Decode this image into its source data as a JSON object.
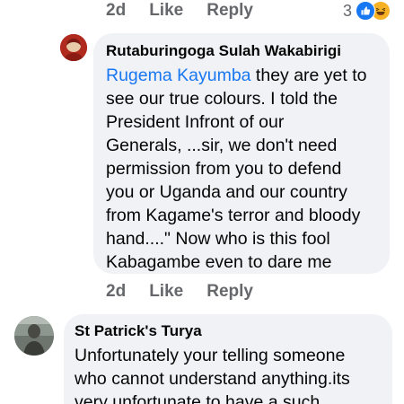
{
  "top_actions": {
    "time": "2d",
    "like": "Like",
    "reply": "Reply",
    "reaction_count": "3",
    "reaction_icons": [
      "like-reaction",
      "haha-reaction"
    ]
  },
  "comment1": {
    "author": "Rutaburingoga Sulah Wakabirigi",
    "mention": "Rugema Kayumba",
    "lines": [
      " they are yet to",
      "see our true colours. I told the",
      "President Infront of our",
      "Generals, ...sir, we don't need",
      "permission from you to defend",
      "you or Uganda and our country",
      "from Kagame's terror and bloody",
      "hand....\" Now who is this fool",
      "Kabagambe even to dare me"
    ],
    "time": "2d",
    "like": "Like",
    "reply": "Reply"
  },
  "comment2": {
    "author": "St Patrick's Turya",
    "lines": [
      "Unfortunately your telling someone",
      "who cannot understand anything.its",
      "very unfortunate to have a such"
    ]
  },
  "colors": {
    "link": "#1877f2",
    "meta": "#65676b",
    "bubble": "#f0f2f5"
  }
}
